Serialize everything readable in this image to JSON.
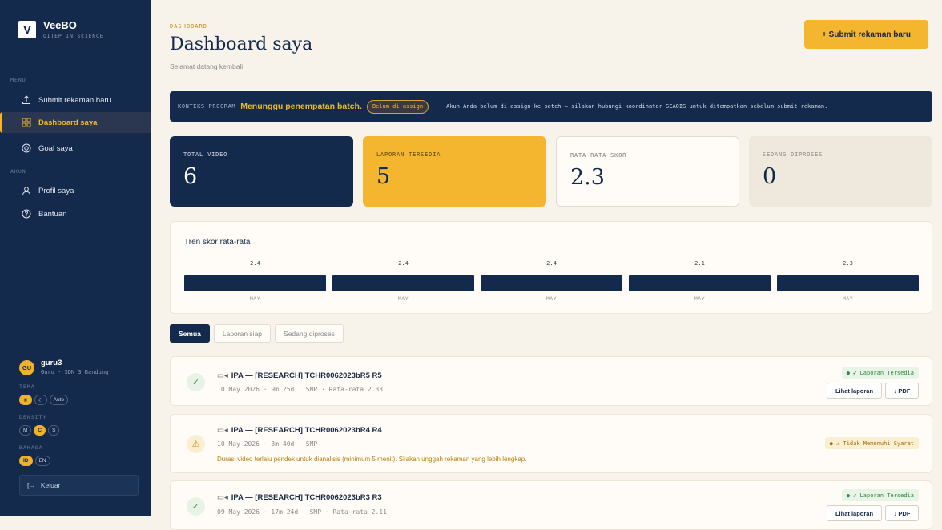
{
  "brand": {
    "name": "VeeBO",
    "sub": "QITEP IN SCIENCE",
    "logo": "V"
  },
  "sidebar": {
    "menu_label": "MENU",
    "items": [
      {
        "label": "Submit rekaman baru",
        "icon": "upload-icon"
      },
      {
        "label": "Dashboard saya",
        "icon": "grid-icon"
      },
      {
        "label": "Goal saya",
        "icon": "target-icon"
      }
    ],
    "account_label": "AKUN",
    "account_items": [
      {
        "label": "Profil saya",
        "icon": "user-icon"
      },
      {
        "label": "Bantuan",
        "icon": "help-icon"
      }
    ],
    "user": {
      "initials": "GU",
      "name": "guru3",
      "sub": "Guru · SDN 3 Bandung"
    },
    "theme_label": "TEMA",
    "theme_options": [
      "☀",
      "☾",
      "Auto"
    ],
    "density_label": "DENSITY",
    "density_options": [
      "M",
      "C",
      "S"
    ],
    "language_label": "BAHASA",
    "language_options": [
      "ID",
      "EN"
    ],
    "logout": "Keluar"
  },
  "header": {
    "crumb": "DASHBOARD",
    "title": "Dashboard saya",
    "subtitle": "Selamat datang kembali,",
    "submit_button": "+ Submit rekaman baru"
  },
  "banner": {
    "label": "KONTEKS PROGRAM",
    "title": "Menunggu penempatan batch.",
    "badge": "Belum di-assign",
    "message": "Akun Anda belum di-assign ke batch — silakan hubungi koordinator SEAQIS untuk ditempatkan sebelum submit rekaman."
  },
  "stats": [
    {
      "label": "TOTAL VIDEO",
      "value": "6"
    },
    {
      "label": "LAPORAN TERSEDIA",
      "value": "5"
    },
    {
      "label": "RATA-RATA SKOR",
      "value": "2.3"
    },
    {
      "label": "SEDANG DIPROSES",
      "value": "0"
    }
  ],
  "trend": {
    "title": "Tren skor rata-rata",
    "bars": [
      {
        "value": "2.4",
        "label": "MAY"
      },
      {
        "value": "2.4",
        "label": "MAY"
      },
      {
        "value": "2.4",
        "label": "MAY"
      },
      {
        "value": "2.1",
        "label": "MAY"
      },
      {
        "value": "2.3",
        "label": "MAY"
      }
    ]
  },
  "tabs": [
    "Semua",
    "Laporan siap",
    "Sedang diproses"
  ],
  "records": [
    {
      "title": "IPA — [RESEARCH] TCHR0062023bR5 R5",
      "meta": "10 May 2026 · 9m 25d · SMP · Rata-rata 2.33",
      "status": "● ✔ Laporan Tersedia",
      "view": "Lihat laporan",
      "pdf": "↓ PDF"
    },
    {
      "title": "IPA — [RESEARCH] TCHR0062023bR4 R4",
      "meta": "10 May 2026 · 3m 40d · SMP",
      "warning": "Durasi video terlalu pendek untuk dianalisis (minimum 5 menit). Silakan unggah rekaman yang lebih lengkap.",
      "status": "● ⚠ Tidak Memenuhi Syarat"
    },
    {
      "title": "IPA — [RESEARCH] TCHR0062023bR3 R3",
      "meta": "09 May 2026 · 17m 24d · SMP · Rata-rata 2.11",
      "status": "● ✔ Laporan Tersedia",
      "view": "Lihat laporan",
      "pdf": "↓ PDF"
    }
  ],
  "colors": {
    "navy": "#142a4c",
    "accent": "#f4b62f",
    "background": "#f7f2ea"
  }
}
